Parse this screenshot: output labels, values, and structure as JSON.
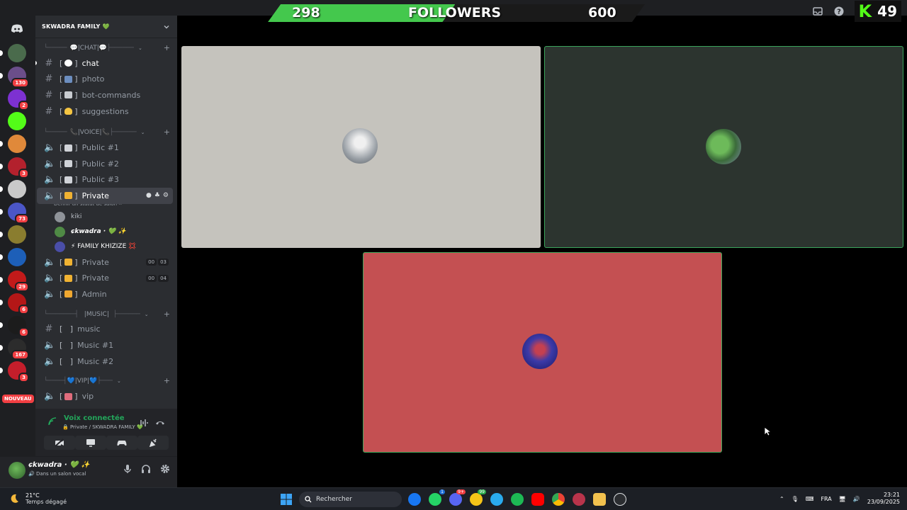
{
  "overlay": {
    "followers_current": "298",
    "followers_label": "FOLLOWERS",
    "followers_goal": "600",
    "progress": 0.497,
    "kick_count": "49"
  },
  "server": {
    "name": "SKWADRA FAMILY 💚"
  },
  "rail": [
    {
      "badge": "",
      "color": "#4a6b4c",
      "pill": true
    },
    {
      "badge": "130",
      "color": "#6b4e8a",
      "pill": true
    },
    {
      "badge": "2",
      "color": "#7d31d1",
      "pill": false
    },
    {
      "badge": "",
      "color": "#53fc18",
      "pill": false
    },
    {
      "badge": "",
      "color": "#e0893a",
      "pill": true
    },
    {
      "badge": "3",
      "color": "#b3212d",
      "pill": true
    },
    {
      "badge": "",
      "color": "#c9c9c9",
      "pill": true
    },
    {
      "badge": "73",
      "color": "#4b56c7",
      "pill": true
    },
    {
      "badge": "",
      "color": "#8a7d2f",
      "pill": true
    },
    {
      "badge": "",
      "color": "#1d5fb8",
      "pill": true
    },
    {
      "badge": "29",
      "color": "#c21a1a",
      "pill": true
    },
    {
      "badge": "6",
      "color": "#b41717",
      "pill": true
    },
    {
      "badge": "6",
      "color": "#1c1c1c",
      "pill": true
    },
    {
      "badge": "167",
      "color": "#2c2c2c",
      "pill": true
    },
    {
      "badge": "3",
      "color": "#c41e2b",
      "pill": true
    }
  ],
  "rail_new": "NOUVEAU",
  "channels": {
    "cat_chat": "|CHAT|",
    "chat": "chat",
    "photo": "photo",
    "bot": "bot-commands",
    "suggestions": "suggestions",
    "cat_voice": "|VOICE|",
    "public1": "Public #1",
    "public2": "Public #2",
    "public3": "Public #3",
    "private_active": "Private",
    "status_hint": "Définir un statut de salon ✏",
    "voice_users": [
      "kiki",
      "ɕkwadra · 💚 ✨",
      "⚡ FAMILY KHIZIZE 💢"
    ],
    "private2": "Private",
    "private2_counts": [
      "00",
      "03"
    ],
    "private3": "Private",
    "private3_counts": [
      "00",
      "04"
    ],
    "admin": "Admin",
    "cat_music": "|MUSIC|",
    "music": "music",
    "music1": "Music #1",
    "music2": "Music #2",
    "cat_vip": "|VIP|",
    "vip": "vip"
  },
  "voice_panel": {
    "title": "Voix connectée",
    "subtitle": "🔒 Private / SKWADRA FAMILY 💚"
  },
  "user": {
    "name": "ɕkwadra · 💚 ✨",
    "status": "🔊 Dans un salon vocal"
  },
  "taskbar": {
    "weather_temp": "21°C",
    "weather_desc": "Temps dégagé",
    "search_placeholder": "Rechercher",
    "lang": "FRA",
    "time": "23:21",
    "date": "23/09/2025",
    "badges": {
      "whatsapp": "1",
      "discord": "9+",
      "norton": "99"
    }
  },
  "colors": {
    "discord_green": "#23a55a",
    "kick_green": "#53fc18",
    "tile1": "#c5c3bd",
    "tile2": "#2c342f",
    "tile3": "#c45052"
  }
}
